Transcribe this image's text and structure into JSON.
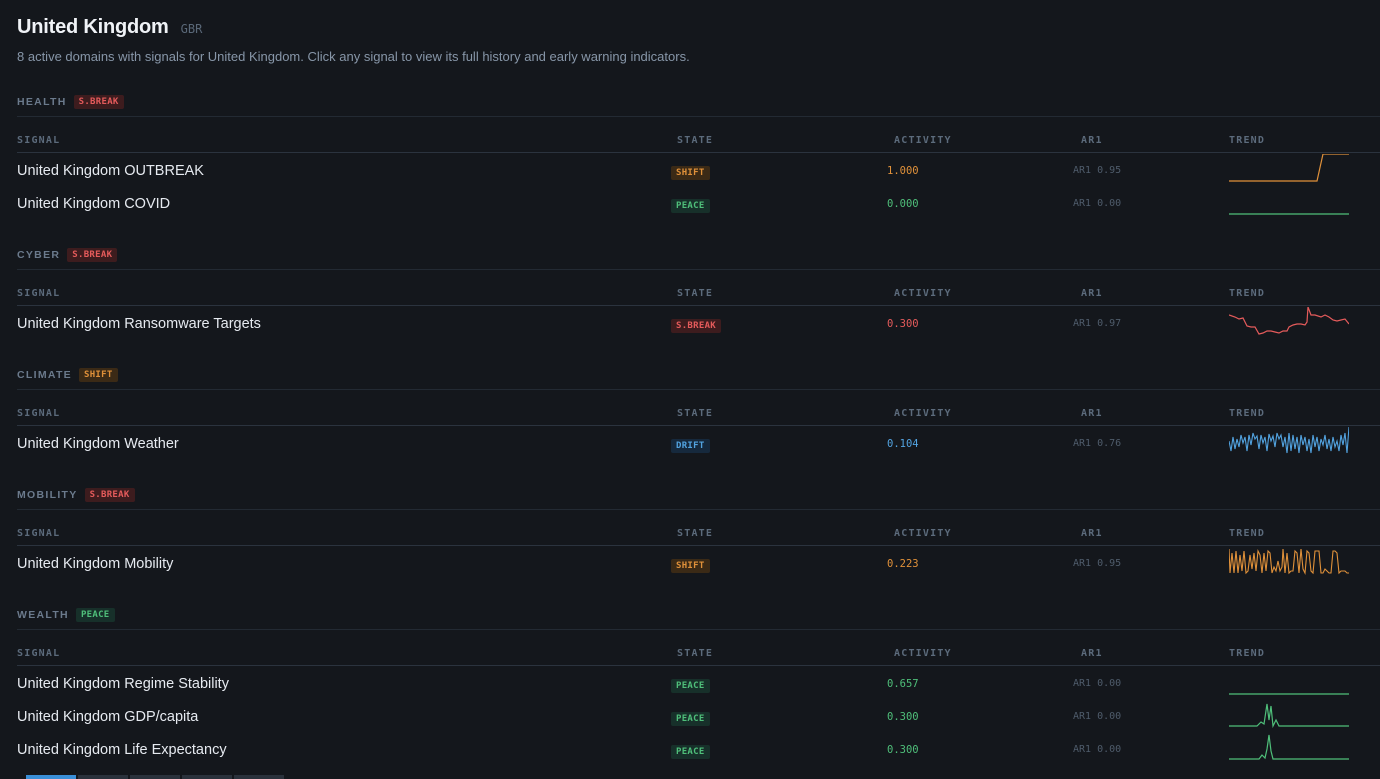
{
  "header": {
    "title": "United Kingdom",
    "iso": "GBR",
    "subtitle": "8 active domains with signals for United Kingdom. Click any signal to view its full history and early warning indicators."
  },
  "columns": {
    "signal": "SIGNAL",
    "state": "STATE",
    "activity": "ACTIVITY",
    "ar1": "AR1",
    "trend": "TREND"
  },
  "sections": [
    {
      "name": "HEALTH",
      "state": "S.BREAK",
      "state_class": "break",
      "rows": [
        {
          "name": "United Kingdom OUTBREAK",
          "state": "SHIFT",
          "state_class": "shift",
          "activity": "1.000",
          "ar1": "AR1 0.95",
          "trend_color": "#e0913a"
        },
        {
          "name": "United Kingdom COVID",
          "state": "PEACE",
          "state_class": "peace",
          "activity": "0.000",
          "ar1": "AR1 0.00",
          "trend_color": "#4fbf7a"
        }
      ]
    },
    {
      "name": "CYBER",
      "state": "S.BREAK",
      "state_class": "break",
      "rows": [
        {
          "name": "United Kingdom Ransomware Targets",
          "state": "S.BREAK",
          "state_class": "break",
          "activity": "0.300",
          "ar1": "AR1 0.97",
          "trend_color": "#e55b5b"
        }
      ]
    },
    {
      "name": "CLIMATE",
      "state": "SHIFT",
      "state_class": "shift",
      "rows": [
        {
          "name": "United Kingdom Weather",
          "state": "DRIFT",
          "state_class": "drift",
          "activity": "0.104",
          "ar1": "AR1 0.76",
          "trend_color": "#52a3e0"
        }
      ]
    },
    {
      "name": "MOBILITY",
      "state": "S.BREAK",
      "state_class": "break",
      "rows": [
        {
          "name": "United Kingdom Mobility",
          "state": "SHIFT",
          "state_class": "shift",
          "activity": "0.223",
          "ar1": "AR1 0.95",
          "trend_color": "#e0913a"
        }
      ]
    },
    {
      "name": "WEALTH",
      "state": "PEACE",
      "state_class": "peace",
      "rows": [
        {
          "name": "United Kingdom Regime Stability",
          "state": "PEACE",
          "state_class": "peace",
          "activity": "0.657",
          "ar1": "AR1 0.00",
          "trend_color": "#4fbf7a"
        },
        {
          "name": "United Kingdom GDP/capita",
          "state": "PEACE",
          "state_class": "peace",
          "activity": "0.300",
          "ar1": "AR1 0.00",
          "trend_color": "#4fbf7a"
        },
        {
          "name": "United Kingdom Life Expectancy",
          "state": "PEACE",
          "state_class": "peace",
          "activity": "0.300",
          "ar1": "AR1 0.00",
          "trend_color": "#4fbf7a"
        }
      ]
    }
  ]
}
